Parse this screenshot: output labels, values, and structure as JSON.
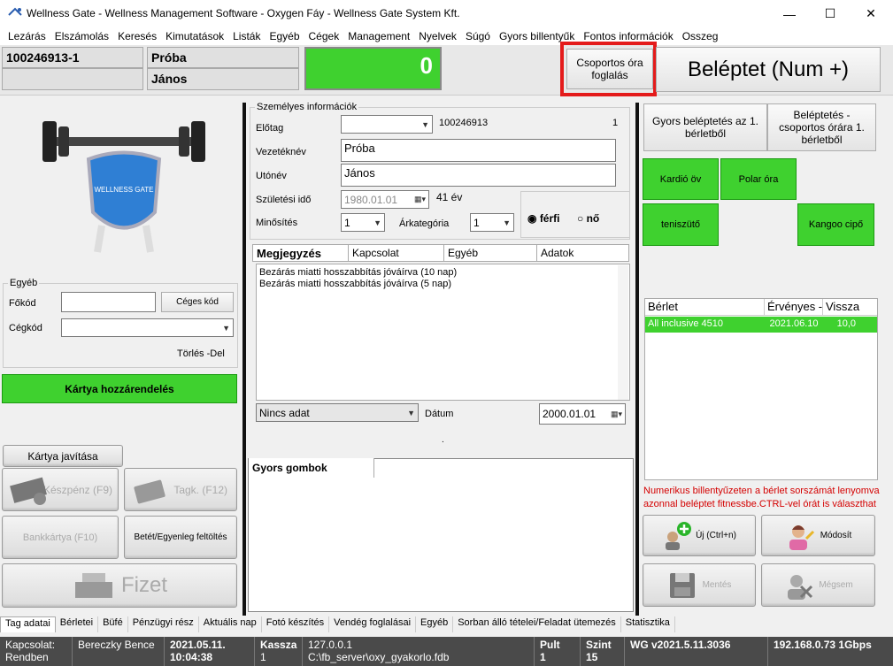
{
  "window": {
    "title": "Wellness Gate - Wellness Management Software - Oxygen Fáy - Wellness Gate System Kft.",
    "minimize": "—",
    "maximize": "☐",
    "close": "✕"
  },
  "menu": [
    "Lezárás",
    "Elszámolás",
    "Keresés",
    "Kimutatások",
    "Listák",
    "Egyéb",
    "Cégek",
    "Management",
    "Nyelvek",
    "Súgó",
    "Gyors billentyűk",
    "Fontos információk",
    "Osszeg"
  ],
  "info": {
    "id": "100246913-1",
    "last_name": "Próba",
    "first_name": "János",
    "balance": "0",
    "group_class_button": "Csoportos óra foglalás",
    "enter_button": "Beléptet (Num +)"
  },
  "left": {
    "egyeb_legend": "Egyéb",
    "fokod_label": "Főkód",
    "cegkod_label": "Cégkód",
    "ceges_kod_button": "Céges kód",
    "torles": "Törlés -Del",
    "card_assign": "Kártya hozzárendelés",
    "card_repair": "Kártya javítása",
    "cash": "Készpénz (F9)",
    "tagk": "Tagk. (F12)",
    "bankcard": "Bankkártya (F10)",
    "deposit": "Betét/Egyenleg feltöltés",
    "pay": "Fizet"
  },
  "personal": {
    "legend": "Személyes információk",
    "elotag_label": "Előtag",
    "id_value": "100246913",
    "count": "1",
    "vezeteknev_label": "Vezetéknév",
    "vezeteknev": "Próba",
    "utonev_label": "Utónév",
    "utonev": "János",
    "szuletesi_label": "Születési idő",
    "szuletesi": "1980.01.01",
    "age": "41 év",
    "minosites_label": "Minősítés",
    "minosites": "1",
    "arkategoria_label": "Árkategória",
    "arkategoria": "1",
    "ferfi": "férfi",
    "no": "nő"
  },
  "notes": {
    "tabs": [
      "Megjegyzés",
      "Kapcsolat",
      "Egyéb",
      "Adatok"
    ],
    "lines": [
      "Bezárás miatti hosszabbítás jóváírva (10 nap)",
      "Bezárás miatti hosszabbítás jóváírva (5 nap)"
    ],
    "nincs_adat": "Nincs adat",
    "datum_label": "Dátum",
    "datum": "2000.01.01",
    "dot": "."
  },
  "quick": {
    "tab": "Gyors gombok"
  },
  "right": {
    "quick_enter": "Gyors beléptetés az 1. bérletből",
    "group_enter": "Beléptetés - csoportos órára 1. bérletből",
    "kardio": "Kardió öv",
    "polar": "Polar óra",
    "teniszuto": "teniszütő",
    "kangoo": "Kangoo cipő",
    "table_headers": [
      "Bérlet",
      "Érvényes -",
      "Vissza"
    ],
    "table_rows": [
      [
        "All inclusive 4510",
        "2021.06.10",
        "10,0"
      ]
    ],
    "hint": "Numerikus billentyűzeten a bérlet sorszámát lenyomva azonnal beléptet fitnessbe.CTRL-vel órát is választhat",
    "new": "Új (Ctrl+n)",
    "modify": "Módosít",
    "save": "Mentés",
    "cancel": "Mégsem"
  },
  "bottom_tabs": [
    "Tag adatai",
    "Bérletei",
    "Büfé",
    "Pénzügyi rész",
    "Aktuális nap",
    "Fotó készítés",
    "Vendég foglalásai",
    "Egyéb",
    "Sorban álló tételei/Feladat ütemezés",
    "Statisztika"
  ],
  "status": {
    "kapcsolat": "Kapcsolat:",
    "rendben": "Rendben",
    "user": "Bereczky Bence",
    "date": "2021.05.11.",
    "time": "10:04:38",
    "kassza_label": "Kassza",
    "kassza": "1",
    "ip": "127.0.0.1",
    "db": "C:\\fb_server\\oxy_gyakorlo.fdb",
    "pult_label": "Pult",
    "pult": "1",
    "szint_label": "Szint",
    "szint": "15",
    "version": "WG v2021.5.11.3036",
    "net": "192.168.0.73 1Gbps"
  },
  "colors": {
    "green": "#3fd12f",
    "red_highlight": "#e41b1b",
    "hint_red": "#d40000"
  }
}
